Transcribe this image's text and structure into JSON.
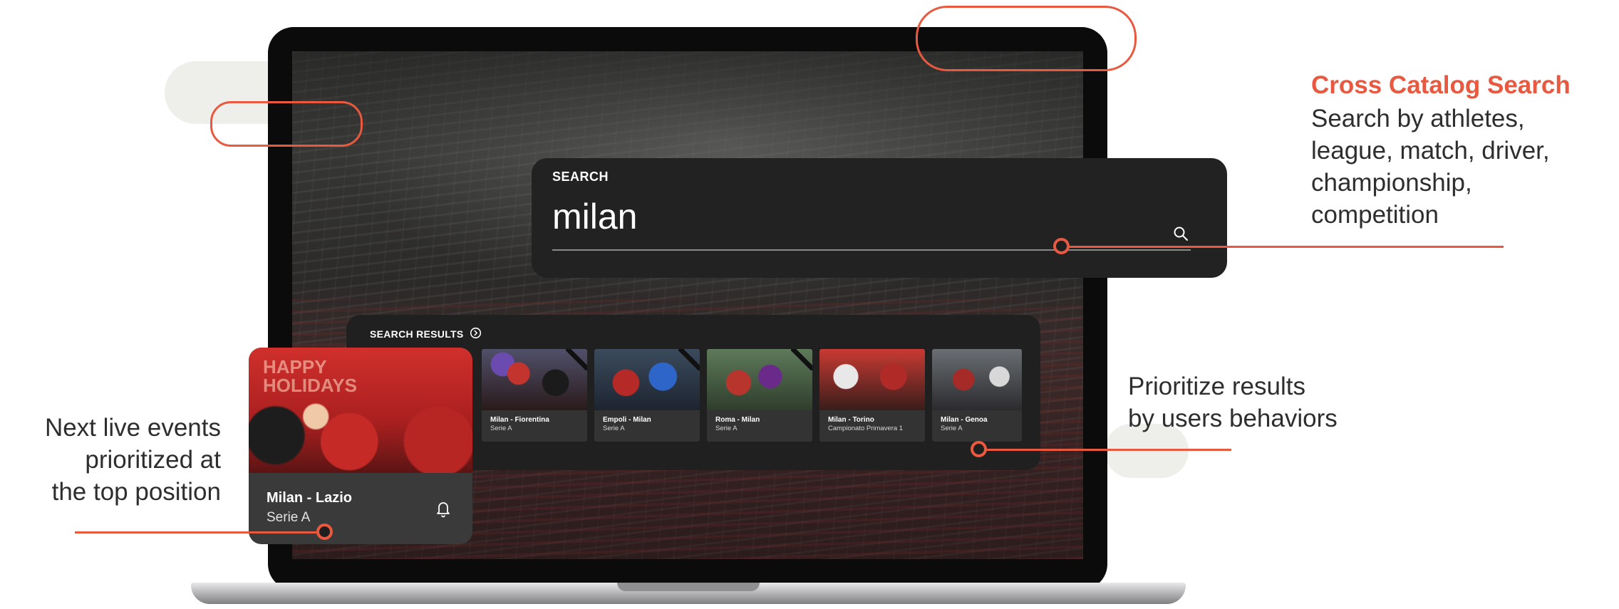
{
  "callouts": {
    "cross_catalog": {
      "title": "Cross Catalog Search",
      "lines": [
        "Search by athletes,",
        "league, match, driver,",
        "championship,",
        "competition"
      ]
    },
    "prioritize": {
      "lines": [
        "Prioritize results",
        "by users behaviors"
      ]
    },
    "next_live": {
      "lines": [
        "Next live events",
        "prioritized at",
        "the top position"
      ]
    }
  },
  "search": {
    "label": "SEARCH",
    "value": "milan"
  },
  "results": {
    "label": "SEARCH RESULTS",
    "items": [
      {
        "title": "Milan - Fiorentina",
        "subtitle": "Serie A"
      },
      {
        "title": "Empoli - Milan",
        "subtitle": "Serie A"
      },
      {
        "title": "Roma - Milan",
        "subtitle": "Serie A"
      },
      {
        "title": "Milan - Torino",
        "subtitle": "Campionato Primavera 1"
      },
      {
        "title": "Milan - Genoa",
        "subtitle": "Serie A"
      }
    ]
  },
  "featured": {
    "title": "Milan - Lazio",
    "subtitle": "Serie A",
    "image_text": "HAPPY\nHOLIDAYS"
  },
  "icons": {
    "search": "search-icon",
    "results": "chevron-circle-icon",
    "bell": "bell-icon"
  },
  "colors": {
    "accent": "#e8593f",
    "panel": "#222223"
  }
}
